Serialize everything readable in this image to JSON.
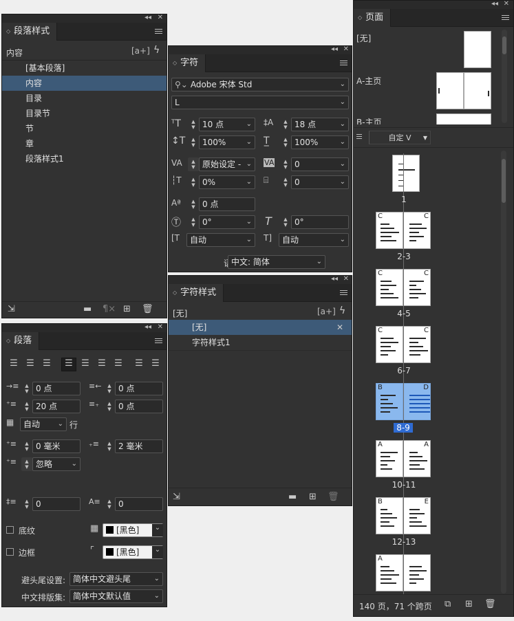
{
  "paragraph_styles": {
    "tab": "段落样式",
    "current": "内容",
    "new_icon": "[a+]",
    "items": [
      "[基本段落]",
      "内容",
      "目录",
      "目录节",
      "节",
      "章",
      "段落样式1"
    ],
    "selected_index": 1
  },
  "character": {
    "tab": "字符",
    "font_family": "Adobe 宋体 Std",
    "font_style": "L",
    "size": "10 点",
    "leading": "18 点",
    "vscale": "100%",
    "hscale": "100%",
    "kerning": "原始设定 -",
    "tracking": "0",
    "tsume": "0%",
    "aki": "0",
    "baseline": "0 点",
    "rotate": "0°",
    "skew": "0°",
    "auto1": "自动",
    "auto2": "自动",
    "language_label": "语言:",
    "language": "中文: 简体"
  },
  "char_styles": {
    "tab": "字符样式",
    "current": "[无]",
    "new_icon": "[a+]",
    "items": [
      "[无]",
      "字符样式1"
    ],
    "selected_index": 0
  },
  "paragraph": {
    "tab": "段落",
    "left_indent": "0 点",
    "right_indent": "0 点",
    "first_indent": "20 点",
    "last_indent": "0 点",
    "grid": "自动",
    "grid_unit": "行",
    "space_before": "0 毫米",
    "space_after": "2 毫米",
    "align_grid": "忽略",
    "drop_lines": "0",
    "drop_chars": "0",
    "shading_label": "底纹",
    "shading_color": "[黑色]",
    "border_label": "边框",
    "border_color": "[黑色]",
    "kinsoku_label": "避头尾设置:",
    "kinsoku": "简体中文避头尾",
    "mojikumi_label": "中文排版集:",
    "mojikumi": "简体中文默认值"
  },
  "pages": {
    "tab": "页面",
    "masters": [
      "[无]",
      "A-主页",
      "B-主页"
    ],
    "view": "自定 V",
    "spreads": [
      {
        "label": "1",
        "left": "",
        "right": ""
      },
      {
        "label": "2-3",
        "left": "C",
        "right": "C"
      },
      {
        "label": "4-5",
        "left": "C",
        "right": "C"
      },
      {
        "label": "6-7",
        "left": "C",
        "right": "C"
      },
      {
        "label": "8-9",
        "left": "B",
        "right": "D"
      },
      {
        "label": "10-11",
        "left": "A",
        "right": "A"
      },
      {
        "label": "12-13",
        "left": "B",
        "right": "E"
      },
      {
        "label": "",
        "left": "A",
        "right": ""
      }
    ],
    "status": "140 页，71 个跨页"
  },
  "colors": {
    "panel": "#323232",
    "selection": "#3d5a78",
    "page_selected": "#8ab8ee"
  }
}
